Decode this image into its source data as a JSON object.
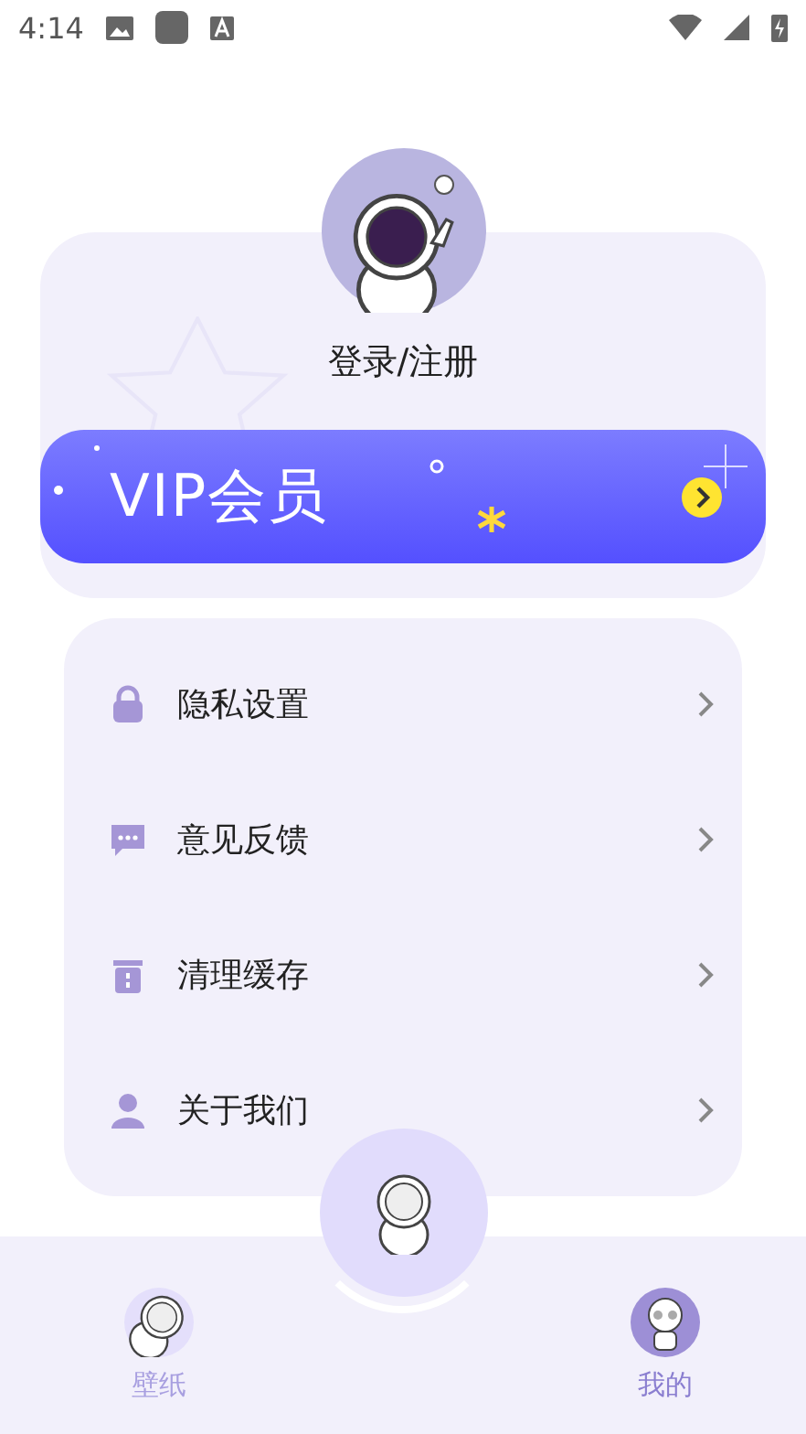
{
  "status_bar": {
    "time": "4:14"
  },
  "profile": {
    "login_label": "登录/注册"
  },
  "vip_banner": {
    "title": "VIP会员"
  },
  "menu": [
    {
      "label": "隐私设置"
    },
    {
      "label": "意见反馈"
    },
    {
      "label": "清理缓存"
    },
    {
      "label": "关于我们"
    }
  ],
  "tab_bar": [
    {
      "label": "壁纸",
      "selected": false
    },
    {
      "label": "我的",
      "selected": true
    }
  ]
}
